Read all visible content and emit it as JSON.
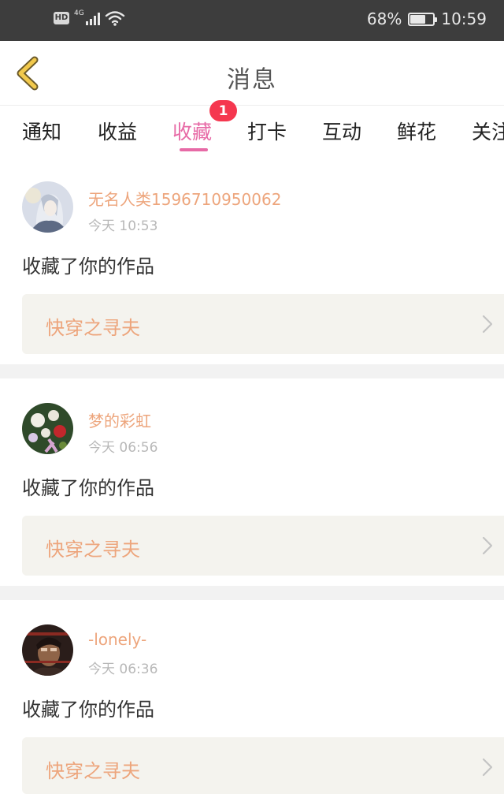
{
  "status_bar": {
    "hd": "HD",
    "network": "4G",
    "battery_percent": "68%",
    "battery_level": 0.68,
    "time": "10:59"
  },
  "header": {
    "back_icon": "chevron-left-icon",
    "title": "消息",
    "accent_color": "#f2c94c"
  },
  "tabs": {
    "items": [
      {
        "label": "通知"
      },
      {
        "label": "收益"
      },
      {
        "label": "收藏"
      },
      {
        "label": "打卡"
      },
      {
        "label": "互动"
      },
      {
        "label": "鲜花"
      },
      {
        "label": "关注"
      }
    ],
    "active_index": 2,
    "active_badge": "1",
    "active_color": "#e76aa6",
    "badge_color": "#f5374f"
  },
  "messages": [
    {
      "username": "无名人类1596710950062",
      "time": "今天 10:53",
      "action": "收藏了你的作品",
      "work_title": "快穿之寻夫"
    },
    {
      "username": "梦的彩虹",
      "time": "今天 06:56",
      "action": "收藏了你的作品",
      "work_title": "快穿之寻夫"
    },
    {
      "username": "-lonely-",
      "time": "今天 06:36",
      "action": "收藏了你的作品",
      "work_title": "快穿之寻夫"
    }
  ],
  "colors": {
    "username": "#eda57c",
    "timestamp": "#b8b8b8",
    "work_background": "#f4f3ee"
  }
}
